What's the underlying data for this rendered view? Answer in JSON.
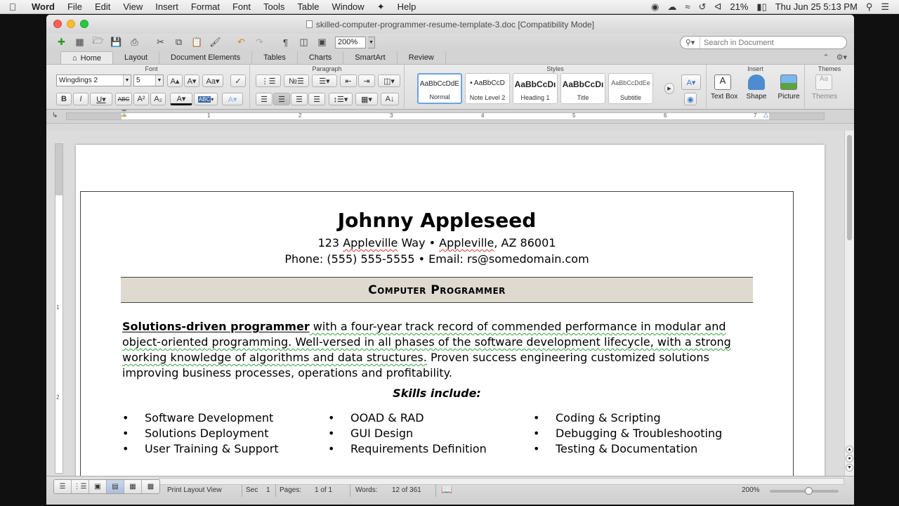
{
  "menubar": {
    "app": "Word",
    "items": [
      "File",
      "Edit",
      "View",
      "Insert",
      "Format",
      "Font",
      "Tools",
      "Table",
      "Window",
      "Help"
    ],
    "battery": "21%",
    "clock": "Thu Jun 25  5:13 PM"
  },
  "window": {
    "title": "skilled-computer-programmer-resume-template-3.doc [Compatibility Mode]",
    "zoom": "200%",
    "search_placeholder": "Search in Document"
  },
  "tabs": [
    "Home",
    "Layout",
    "Document Elements",
    "Tables",
    "Charts",
    "SmartArt",
    "Review"
  ],
  "ribbon": {
    "font_group": "Font",
    "paragraph_group": "Paragraph",
    "styles_group": "Styles",
    "insert_group": "Insert",
    "themes_group": "Themes",
    "font_name": "Wingdings 2",
    "font_size": "5",
    "styles": [
      {
        "sample": "AaBbCcDdE",
        "name": "Normal"
      },
      {
        "sample": "• AaBbCcD",
        "name": "Note Level 2"
      },
      {
        "sample": "AaBbCcDı",
        "name": "Heading 1"
      },
      {
        "sample": "AaBbCcDı",
        "name": "Title"
      },
      {
        "sample": "AaBbCcDdEe",
        "name": "Subtitle"
      }
    ],
    "insert_items": [
      "Text Box",
      "Shape",
      "Picture"
    ],
    "themes_label": "Themes"
  },
  "ruler": {
    "marks": [
      "1",
      "2",
      "3",
      "4",
      "5",
      "6",
      "7"
    ],
    "vmarks": [
      "1",
      "2"
    ]
  },
  "document": {
    "name": "Johnny Appleseed",
    "addr_street": "123 ",
    "addr_street_word": "Appleville",
    "addr_way": " Way",
    "addr_sep": "•",
    "addr_city": "Appleville",
    "addr_rest": ", AZ 86001",
    "phone": "Phone: (555) 555-5555",
    "phone_sep": "•",
    "email": "Email: rs@somedomain.com",
    "banner": "Computer Programmer",
    "summary_bold": "Solutions-driven programmer",
    "summary_green": " with a four-year track record of commended performance in modular and object-oriented programming. Well-versed in all phases of the software development lifecycle, with a strong working knowledge of algorithms and data structures.",
    "summary_rest": " Proven success engineering customized solutions improving business processes, operations and profitability.",
    "skills_heading": "Skills include:",
    "skills_col1": [
      "Software Development",
      "Solutions Deployment",
      "User Training & Support"
    ],
    "skills_col2": [
      "OOAD & RAD",
      "GUI Design",
      "Requirements Definition"
    ],
    "skills_col3": [
      "Coding & Scripting",
      "Debugging & Troubleshooting",
      "Testing & Documentation"
    ]
  },
  "statusbar": {
    "view": "Print Layout View",
    "sec_label": "Sec",
    "sec_value": "1",
    "pages_label": "Pages:",
    "pages_value": "1 of 1",
    "words_label": "Words:",
    "words_value": "12 of 361",
    "zoom": "200%",
    "zoom_level": 0.58
  }
}
